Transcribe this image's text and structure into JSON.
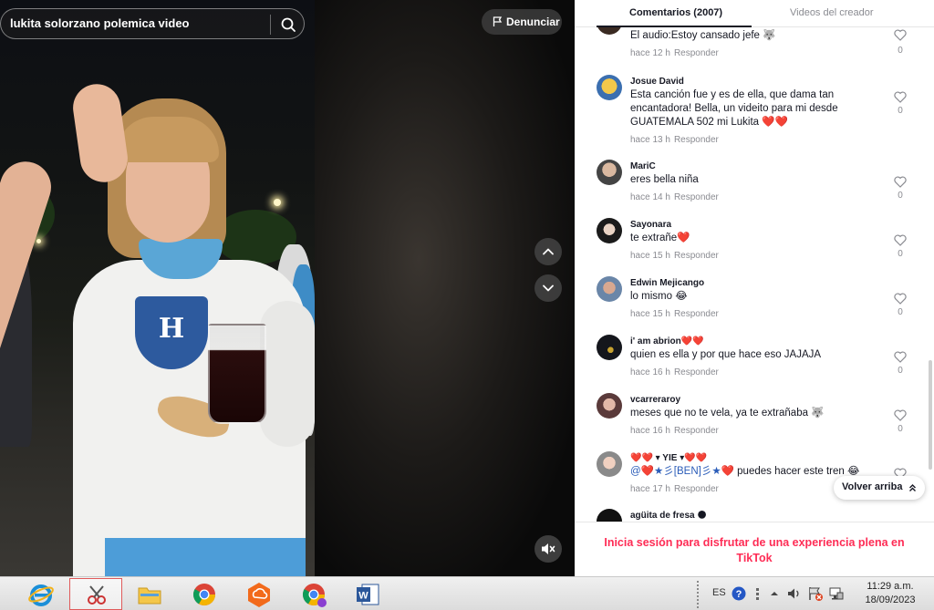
{
  "search": {
    "value": "lukita solorzano polemica video",
    "icon": "search-icon"
  },
  "video": {
    "report_label": "Denunciar",
    "nav_up_icon": "chevron-up-icon",
    "nav_down_icon": "chevron-down-icon",
    "mute_icon": "speaker-muted-icon",
    "crest_letter": "H"
  },
  "panel": {
    "tabs": [
      {
        "label": "Comentarios (2007)",
        "active": true
      },
      {
        "label": "Videos del creador",
        "active": false
      }
    ],
    "comments": [
      {
        "username": "",
        "text": "El audio:Estoy cansado jefe 🐺",
        "time": "hace 12 h",
        "reply": "Responder",
        "likes": "0"
      },
      {
        "username": "Josue David",
        "text": "Esta canción fue y es de ella, que dama tan encantadora! Bella, un videito para mi desde GUATEMALA 502 mi Lukita ❤️❤️",
        "time": "hace 13 h",
        "reply": "Responder",
        "likes": "0"
      },
      {
        "username": "MariC",
        "text": "eres bella niña",
        "time": "hace 14 h",
        "reply": "Responder",
        "likes": "0"
      },
      {
        "username": "Sayonara",
        "text": "te extrañe❤️",
        "time": "hace 15 h",
        "reply": "Responder",
        "likes": "0"
      },
      {
        "username": "Edwin Mejicango",
        "text": "lo mismo 😂",
        "time": "hace 15 h",
        "reply": "Responder",
        "likes": "0"
      },
      {
        "username": "i' am abrion❤️❤️",
        "text": "quien es ella y por que hace eso JAJAJA",
        "time": "hace 16 h",
        "reply": "Responder",
        "likes": "0"
      },
      {
        "username": "vcarreraroy",
        "text": "meses que no te vela, ya te extrañaba 🐺",
        "time": "hace 16 h",
        "reply": "Responder",
        "likes": "0"
      },
      {
        "username": "❤️❤️ ▾ YIE ▾❤️❤️",
        "text_mention": "@❤️★彡[BEN]彡★❤️",
        "text": " puedes hacer este tren 😂",
        "time": "hace 17 h",
        "reply": "Responder",
        "likes": ""
      },
      {
        "username": "agüita de fresa 🌑",
        "text": "",
        "time": "",
        "reply": "",
        "likes": ""
      }
    ],
    "back_to_top": "Volver arriba",
    "login_banner": "Inicia sesión para disfrutar de una experiencia plena en TikTok"
  },
  "taskbar": {
    "apps": [
      {
        "name": "internet-explorer",
        "icon": "ie-icon"
      },
      {
        "name": "snipping-tool",
        "icon": "scissors-icon",
        "active": true
      },
      {
        "name": "file-explorer",
        "icon": "folder-icon"
      },
      {
        "name": "chrome",
        "icon": "chrome-icon"
      },
      {
        "name": "cloud-app",
        "icon": "hexagon-icon"
      },
      {
        "name": "chrome-profile",
        "icon": "chrome-icon"
      },
      {
        "name": "word",
        "icon": "word-icon"
      }
    ],
    "lang": "ES",
    "time": "11:29 a.m.",
    "date": "18/09/2023"
  },
  "colors": {
    "accent": "#fe2c55",
    "text": "#161823",
    "muted": "#8a8b91",
    "link": "#2b5db9"
  }
}
